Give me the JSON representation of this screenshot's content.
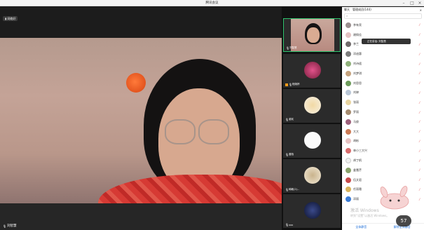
{
  "window": {
    "title": "腾讯会议"
  },
  "main": {
    "network_label": "网络好",
    "speaker_name": "刘智慧"
  },
  "thumbnails": [
    {
      "name": "刘智慧",
      "active": true
    },
    {
      "name": "程婉婷"
    },
    {
      "name": "谢欢"
    },
    {
      "name": "墨陌"
    },
    {
      "name": "韩敏(2)..."
    },
    {
      "name": "xxx"
    }
  ],
  "panel": {
    "tab_chat": "聊天",
    "tab_members": "管理成员(144)",
    "search_placeholder": "",
    "popup": "正在讲话: 刘智慧",
    "members": [
      "李有亮",
      "谢佩佳",
      "李兰",
      "邓迪惠",
      "刘诗遥",
      "刘梦琪",
      "刘思思",
      "刘婷",
      "张丽",
      "罗丽",
      "马俊",
      "大大",
      "胡彬",
      "林小三大兴",
      "胡丁帆",
      "姜慧芹",
      "伍文君",
      "任丽雅",
      "邓丽"
    ],
    "footer_left": "全体静音",
    "footer_right": "解除全体静音"
  },
  "overlay": {
    "watermark_line1": "激活 Windows",
    "watermark_line2": "转到“设置”以激活 Windows。",
    "clock": "57"
  }
}
